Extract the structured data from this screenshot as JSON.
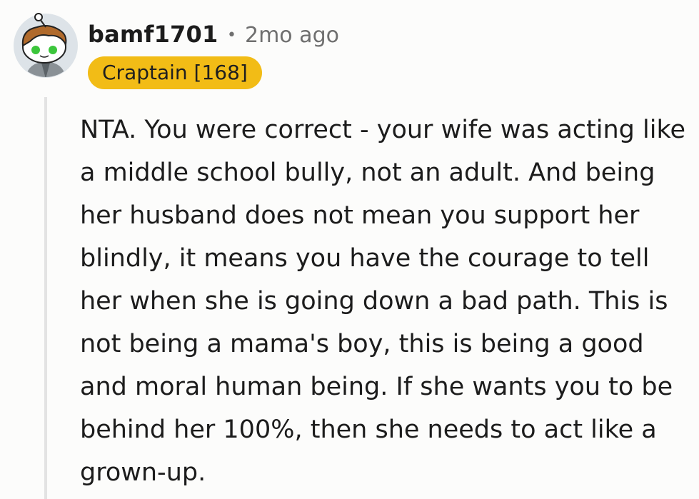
{
  "comment": {
    "author": "bamf1701",
    "separator": "•",
    "age": "2mo ago",
    "flair": "Craptain [168]",
    "body": "NTA. You were correct - your wife was acting like a middle school bully, not an adult. And being her husband does not mean you support her blindly, it means you have the courage to tell her when she is going down a bad path. This is not being a mama's boy, this is being a good and moral human being. If she wants you to be behind her 100%, then she needs to act like a grown-up."
  },
  "colors": {
    "background": "#fcfcfb",
    "flair_background": "#f2bc16",
    "meta_text": "#6f6f6f",
    "thread_line": "#e3e3e3"
  },
  "icons": {
    "avatar": "reddit-snoo-avatar-icon"
  }
}
